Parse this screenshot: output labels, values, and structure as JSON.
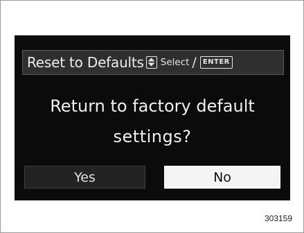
{
  "dialog": {
    "title": "Reset to Defaults",
    "select_hint": "Select",
    "slash": "/",
    "enter_key": "ENTER",
    "message_line1": "Return to factory default",
    "message_line2": "settings?",
    "yes_label": "Yes",
    "no_label": "No",
    "selected": "No"
  },
  "figure_id": "303159",
  "colors": {
    "screen_bg": "#0b0b0b",
    "title_bar_bg": "#2f2f2f",
    "selected_button_bg": "#f4f4f4",
    "unselected_button_bg": "#232323"
  },
  "icons": [
    "updown-icon",
    "enter-key-icon"
  ]
}
